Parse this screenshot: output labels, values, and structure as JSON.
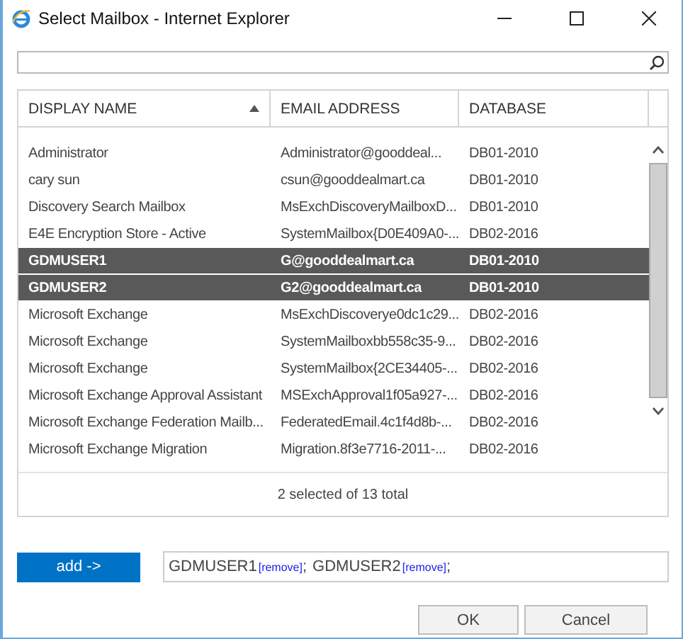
{
  "window": {
    "title": "Select Mailbox - Internet Explorer"
  },
  "table": {
    "columns": [
      {
        "label": "DISPLAY NAME",
        "sorted": true
      },
      {
        "label": "EMAIL ADDRESS",
        "sorted": false
      },
      {
        "label": "DATABASE",
        "sorted": false
      }
    ],
    "rows": [
      {
        "cells": [
          "Administrator",
          "Administrator@gooddeal...",
          "DB01-2010"
        ],
        "selected": false
      },
      {
        "cells": [
          "cary sun",
          "csun@gooddealmart.ca",
          "DB01-2010"
        ],
        "selected": false
      },
      {
        "cells": [
          "Discovery Search Mailbox",
          "MsExchDiscoveryMailboxD...",
          "DB01-2010"
        ],
        "selected": false
      },
      {
        "cells": [
          "E4E Encryption Store - Active",
          "SystemMailbox{D0E409A0-...",
          "DB02-2016"
        ],
        "selected": false
      },
      {
        "cells": [
          "GDMUSER1",
          "G@gooddealmart.ca",
          "DB01-2010"
        ],
        "selected": true
      },
      {
        "cells": [
          "GDMUSER2",
          "G2@gooddealmart.ca",
          "DB01-2010"
        ],
        "selected": true
      },
      {
        "cells": [
          "Microsoft Exchange",
          "MsExchDiscoverye0dc1c29...",
          "DB02-2016"
        ],
        "selected": false
      },
      {
        "cells": [
          "Microsoft Exchange",
          "SystemMailboxbb558c35-9...",
          "DB02-2016"
        ],
        "selected": false
      },
      {
        "cells": [
          "Microsoft Exchange",
          "SystemMailbox{2CE34405-...",
          "DB02-2016"
        ],
        "selected": false
      },
      {
        "cells": [
          "Microsoft Exchange Approval Assistant",
          "MSExchApproval1f05a927-...",
          "DB02-2016"
        ],
        "selected": false
      },
      {
        "cells": [
          "Microsoft Exchange Federation Mailb...",
          "FederatedEmail.4c1f4d8b-...",
          "DB02-2016"
        ],
        "selected": false
      },
      {
        "cells": [
          "Microsoft Exchange Migration",
          "Migration.8f3e7716-2011-...",
          "DB02-2016"
        ],
        "selected": false
      }
    ],
    "status": "2 selected of 13 total"
  },
  "add_button": "add ->",
  "selection": [
    {
      "name": "GDMUSER1",
      "remove": "[remove]",
      "separator": ";"
    },
    {
      "name": "GDMUSER2",
      "remove": "[remove]",
      "separator": ";"
    }
  ],
  "buttons": [
    "OK",
    "Cancel"
  ]
}
